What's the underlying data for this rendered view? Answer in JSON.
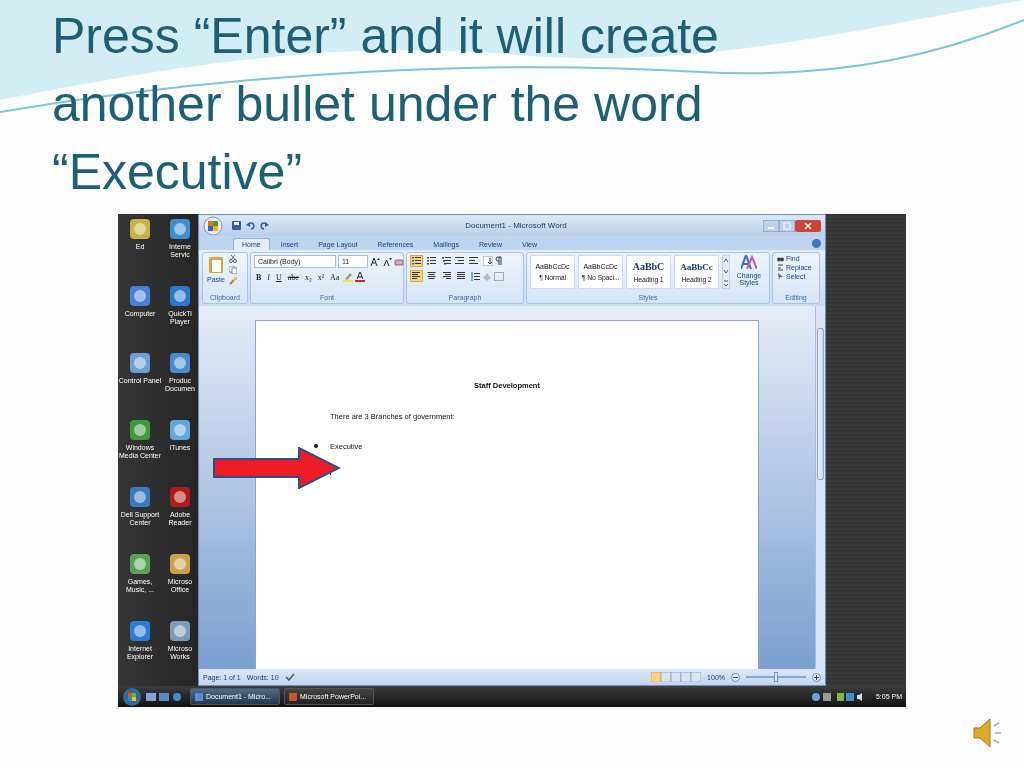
{
  "slide": {
    "title_lines": [
      "Press “Enter” and it will create",
      "another bullet under the word",
      "“Executive”"
    ]
  },
  "desktop": {
    "icons": [
      {
        "label": "Ed"
      },
      {
        "label": "Interne Servic"
      },
      {
        "label": "Computer"
      },
      {
        "label": "QuickTi Player"
      },
      {
        "label": "Control Panel"
      },
      {
        "label": "Produc Documen"
      },
      {
        "label": "Windows Media Center"
      },
      {
        "label": "iTunes"
      },
      {
        "label": "Dell Support Center"
      },
      {
        "label": "Adobe Reader"
      },
      {
        "label": "Games, Music, ..."
      },
      {
        "label": "Microso Office"
      },
      {
        "label": "Internet Explorer"
      },
      {
        "label": "Microso Works"
      }
    ]
  },
  "word": {
    "title": "Document1 - Microsoft Word",
    "tabs": [
      {
        "label": "Home",
        "selected": true
      },
      {
        "label": "Insert",
        "selected": false
      },
      {
        "label": "Page Layout",
        "selected": false
      },
      {
        "label": "References",
        "selected": false
      },
      {
        "label": "Mailings",
        "selected": false
      },
      {
        "label": "Review",
        "selected": false
      },
      {
        "label": "View",
        "selected": false
      }
    ],
    "ribbon": {
      "clipboard": {
        "paste": "Paste",
        "label": "Clipboard"
      },
      "font": {
        "name": "Calibri (Body)",
        "size": "11",
        "label": "Font",
        "buttons": [
          {
            "label": "B",
            "kind": "bold"
          },
          {
            "label": "I",
            "kind": "italic"
          },
          {
            "label": "U",
            "kind": "underline"
          },
          {
            "label": "abe",
            "kind": "strike"
          },
          {
            "label": "x₂",
            "kind": "plain"
          },
          {
            "label": "x²",
            "kind": "plain"
          },
          {
            "label": "Aa",
            "kind": "plain"
          }
        ]
      },
      "paragraph": {
        "label": "Paragraph",
        "buttons": [
          {
            "kind": "bullets",
            "selected": true
          },
          {
            "kind": "numbering",
            "selected": false
          },
          {
            "kind": "multilevel",
            "selected": false
          },
          {
            "kind": "align-left",
            "selected": true
          },
          {
            "kind": "center",
            "selected": false
          },
          {
            "kind": "align-right",
            "selected": false
          },
          {
            "kind": "justify",
            "selected": false
          }
        ]
      },
      "styles": {
        "label": "Styles",
        "change": "Change Styles",
        "items": [
          {
            "preview": "AaBbCcDc",
            "name": "¶ Normal",
            "kind": "body"
          },
          {
            "preview": "AaBbCcDc",
            "name": "¶ No Spaci...",
            "kind": "body"
          },
          {
            "preview": "AaBbC",
            "name": "Heading 1",
            "kind": "heading1"
          },
          {
            "preview": "AaBbCc",
            "name": "Heading 2",
            "kind": "heading2"
          }
        ]
      },
      "editing": {
        "label": "Editing",
        "items": [
          "Find",
          "Replace",
          "Select"
        ]
      }
    },
    "document": {
      "heading": "Staff Development",
      "paragraph": "There are 3 Branches of government:",
      "bullets": [
        {
          "kind": "text",
          "text": "Executive"
        },
        {
          "kind": "cursor"
        }
      ]
    },
    "status_bar": {
      "page": "Page: 1 of 1",
      "words": "Words: 10",
      "zoom": "100%",
      "zoom_slider": {
        "level": 0.5
      }
    }
  },
  "taskbar": {
    "tasks": [
      {
        "label": "Document1 - Micro...",
        "selected": true
      },
      {
        "label": "Microsoft PowerPoi...",
        "selected": false
      }
    ],
    "clock": "5:05 PM"
  }
}
